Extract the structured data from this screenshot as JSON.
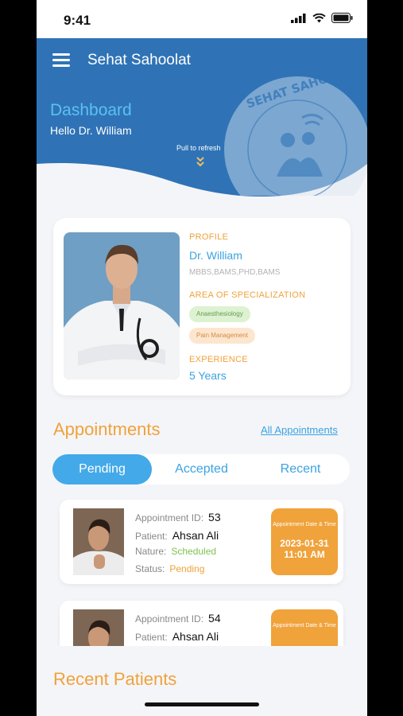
{
  "status_bar": {
    "time": "9:41"
  },
  "header": {
    "app_title": "Sehat Sahoolat",
    "dashboard_title": "Dashboard",
    "greeting": "Hello Dr. William",
    "pull_hint": "Pull to refresh",
    "logo_text": "SEHAT SAHOOLAT"
  },
  "profile": {
    "section_label": "PROFILE",
    "name": "Dr. William",
    "qualifications": "MBBS,BAMS,PHD,BAMS",
    "specialization_label": "AREA OF SPECIALIZATION",
    "specializations": [
      "Anaesthesiology",
      "Pain Management"
    ],
    "experience_label": "EXPERIENCE",
    "experience": "5 Years"
  },
  "appointments": {
    "title": "Appointments",
    "all_link": "All Appointments",
    "tabs": [
      "Pending",
      "Accepted",
      "Recent"
    ],
    "active_tab": "Pending",
    "labels": {
      "id": "Appointment ID:",
      "patient": "Patient:",
      "nature": "Nature:",
      "status": "Status:",
      "date_time": "Appointment Date & Time"
    },
    "items": [
      {
        "id": "53",
        "patient": "Ahsan Ali",
        "nature": "Scheduled",
        "status": "Pending",
        "date": "2023-01-31",
        "time": "11:01 AM"
      },
      {
        "id": "54",
        "patient": "Ahsan Ali"
      }
    ]
  },
  "recent_patients": {
    "title": "Recent Patients"
  },
  "colors": {
    "primary_blue": "#2f73b6",
    "accent_blue": "#3aa3e3",
    "orange": "#f0a23b",
    "green": "#7cc34f"
  }
}
